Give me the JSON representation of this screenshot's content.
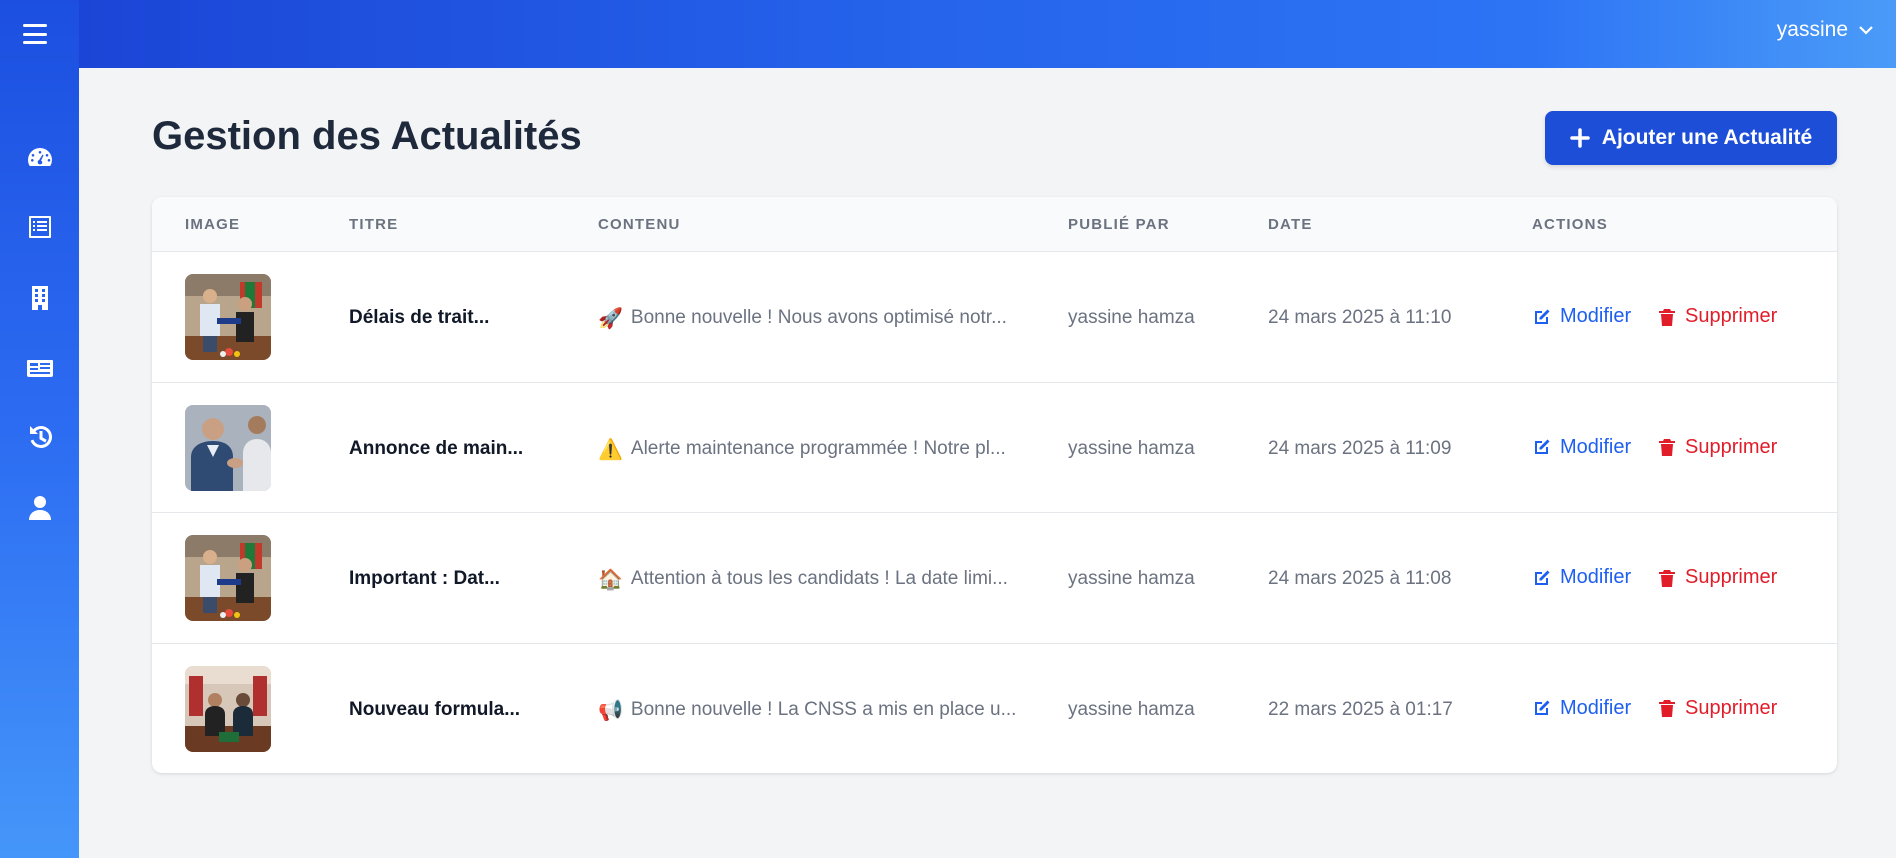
{
  "user": {
    "name": "yassine"
  },
  "page": {
    "title": "Gestion des Actualités"
  },
  "actions": {
    "add_label": "Ajouter une Actualité"
  },
  "table": {
    "headers": [
      "Image",
      "Titre",
      "Contenu",
      "Publié par",
      "Date",
      "Actions"
    ],
    "rows": [
      {
        "title": "Délais de trait...",
        "emoji": "🚀",
        "content": "Bonne nouvelle ! Nous avons optimisé notr...",
        "author": "yassine hamza",
        "date": "24 mars 2025 à 11:10",
        "edit": "Modifier",
        "delete": "Supprimer"
      },
      {
        "title": "Annonce de main...",
        "emoji": "⚠️",
        "content": "Alerte maintenance programmée ! Notre pl...",
        "author": "yassine hamza",
        "date": "24 mars 2025 à 11:09",
        "edit": "Modifier",
        "delete": "Supprimer"
      },
      {
        "title": "Important : Dat...",
        "emoji": "🏠",
        "content": "Attention à tous les candidats ! La date limi...",
        "author": "yassine hamza",
        "date": "24 mars 2025 à 11:08",
        "edit": "Modifier",
        "delete": "Supprimer"
      },
      {
        "title": "Nouveau formula...",
        "emoji": "📢",
        "content": "Bonne nouvelle ! La CNSS a mis en place u...",
        "author": "yassine hamza",
        "date": "22 mars 2025 à 01:17",
        "edit": "Modifier",
        "delete": "Supprimer"
      }
    ]
  },
  "colors": {
    "primary": "#1d4ed8",
    "edit": "#1d5ff0",
    "delete": "#e11d2a",
    "sidebar_top": "#1c4fe0",
    "sidebar_bottom": "#4596fa"
  },
  "icons": {
    "sidebar": [
      "menu-icon",
      "dashboard-icon",
      "news-list-icon",
      "building-icon",
      "newspaper-icon",
      "history-icon",
      "user-icon"
    ]
  }
}
